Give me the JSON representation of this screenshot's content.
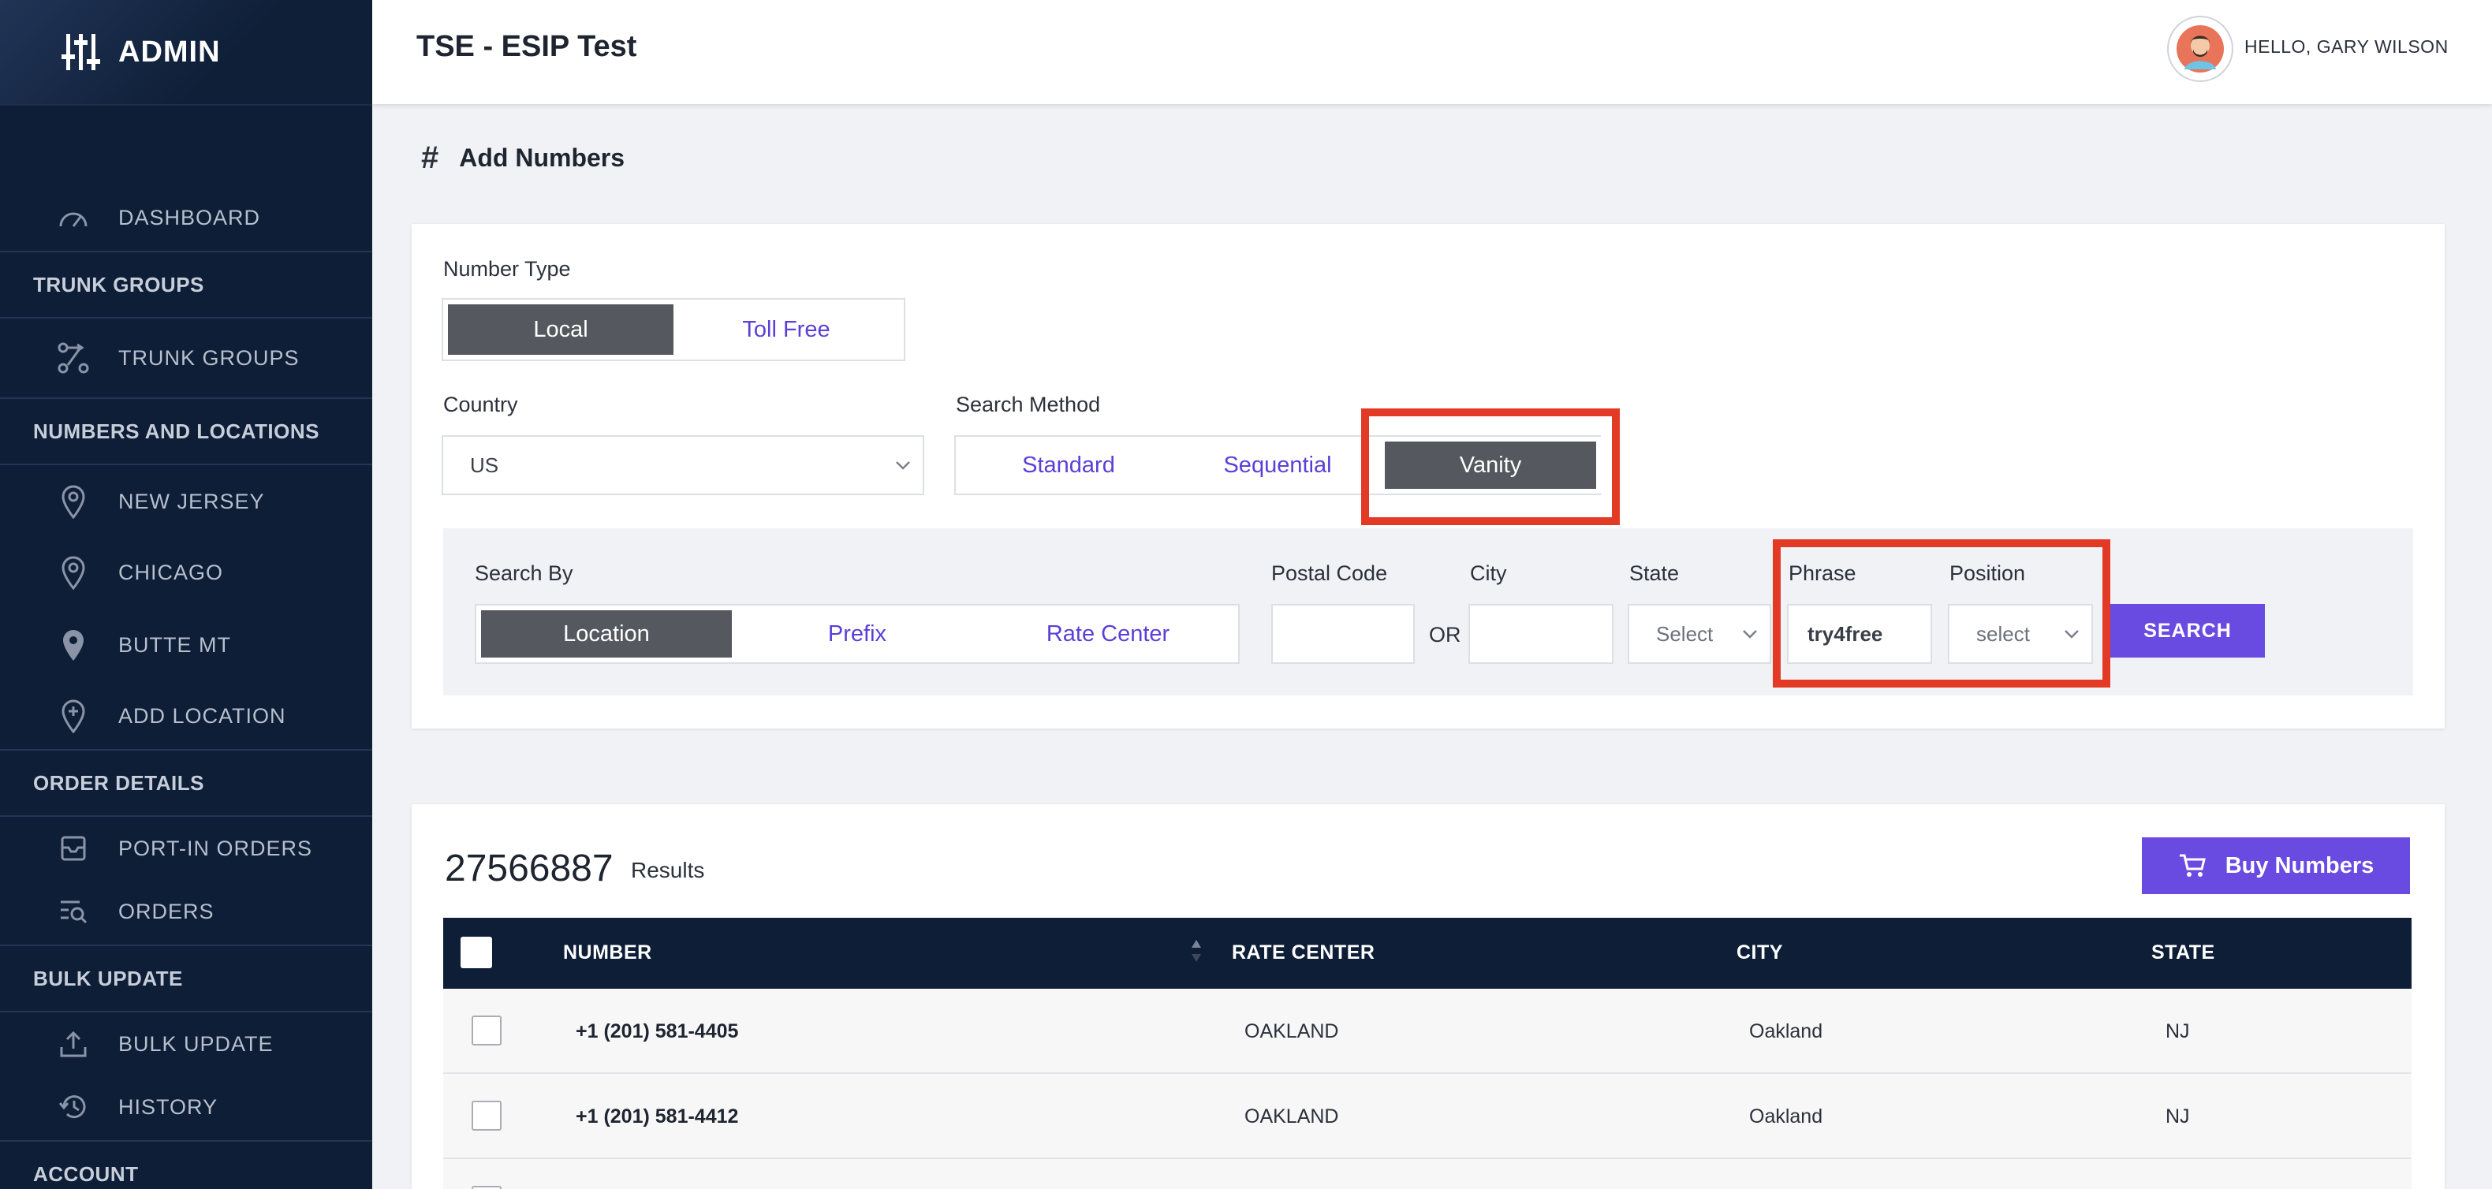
{
  "sidebar": {
    "brand": "ADMIN",
    "items": {
      "dashboard": "DASHBOARD",
      "trunk_groups": "TRUNK GROUPS",
      "new_jersey": "NEW JERSEY",
      "chicago": "CHICAGO",
      "butte_mt": "BUTTE MT",
      "add_location": "ADD LOCATION",
      "port_in_orders": "PORT-IN ORDERS",
      "orders": "ORDERS",
      "bulk_update": "BULK UPDATE",
      "history": "HISTORY"
    },
    "sections": {
      "trunk_groups": "TRUNK GROUPS",
      "numbers_locations": "NUMBERS AND LOCATIONS",
      "order_details": "ORDER DETAILS",
      "bulk_update": "BULK UPDATE",
      "account": "ACCOUNT"
    }
  },
  "header": {
    "title": "TSE - ESIP Test",
    "greeting": "HELLO, GARY WILSON"
  },
  "page": {
    "title": "Add Numbers"
  },
  "search": {
    "number_type_label": "Number Type",
    "number_type_options": [
      "Local",
      "Toll Free"
    ],
    "number_type_selected": "Local",
    "country_label": "Country",
    "country_value": "US",
    "search_method_label": "Search Method",
    "search_method_options": [
      "Standard",
      "Sequential",
      "Vanity"
    ],
    "search_method_selected": "Vanity",
    "search_by_label": "Search By",
    "search_by_options": [
      "Location",
      "Prefix",
      "Rate Center"
    ],
    "search_by_selected": "Location",
    "postal_code_label": "Postal Code",
    "postal_code_value": "",
    "or_text": "OR",
    "city_label": "City",
    "city_value": "",
    "state_label": "State",
    "state_value": "Select",
    "phrase_label": "Phrase",
    "phrase_value": "try4free",
    "position_label": "Position",
    "position_value": "select",
    "search_button": "SEARCH"
  },
  "results": {
    "count": "27566887",
    "label": "Results",
    "buy_button": "Buy Numbers",
    "columns": [
      "NUMBER",
      "RATE CENTER",
      "CITY",
      "STATE"
    ],
    "rows": [
      {
        "number": "+1 (201) 581-4405",
        "rate_center": "OAKLAND",
        "city": "Oakland",
        "state": "NJ"
      },
      {
        "number": "+1 (201) 581-4412",
        "rate_center": "OAKLAND",
        "city": "Oakland",
        "state": "NJ"
      }
    ]
  },
  "colors": {
    "sidebar_bg": "#0e1e37",
    "accent": "#6a4be2",
    "active_segment": "#55595f",
    "highlight": "#e23a25"
  }
}
